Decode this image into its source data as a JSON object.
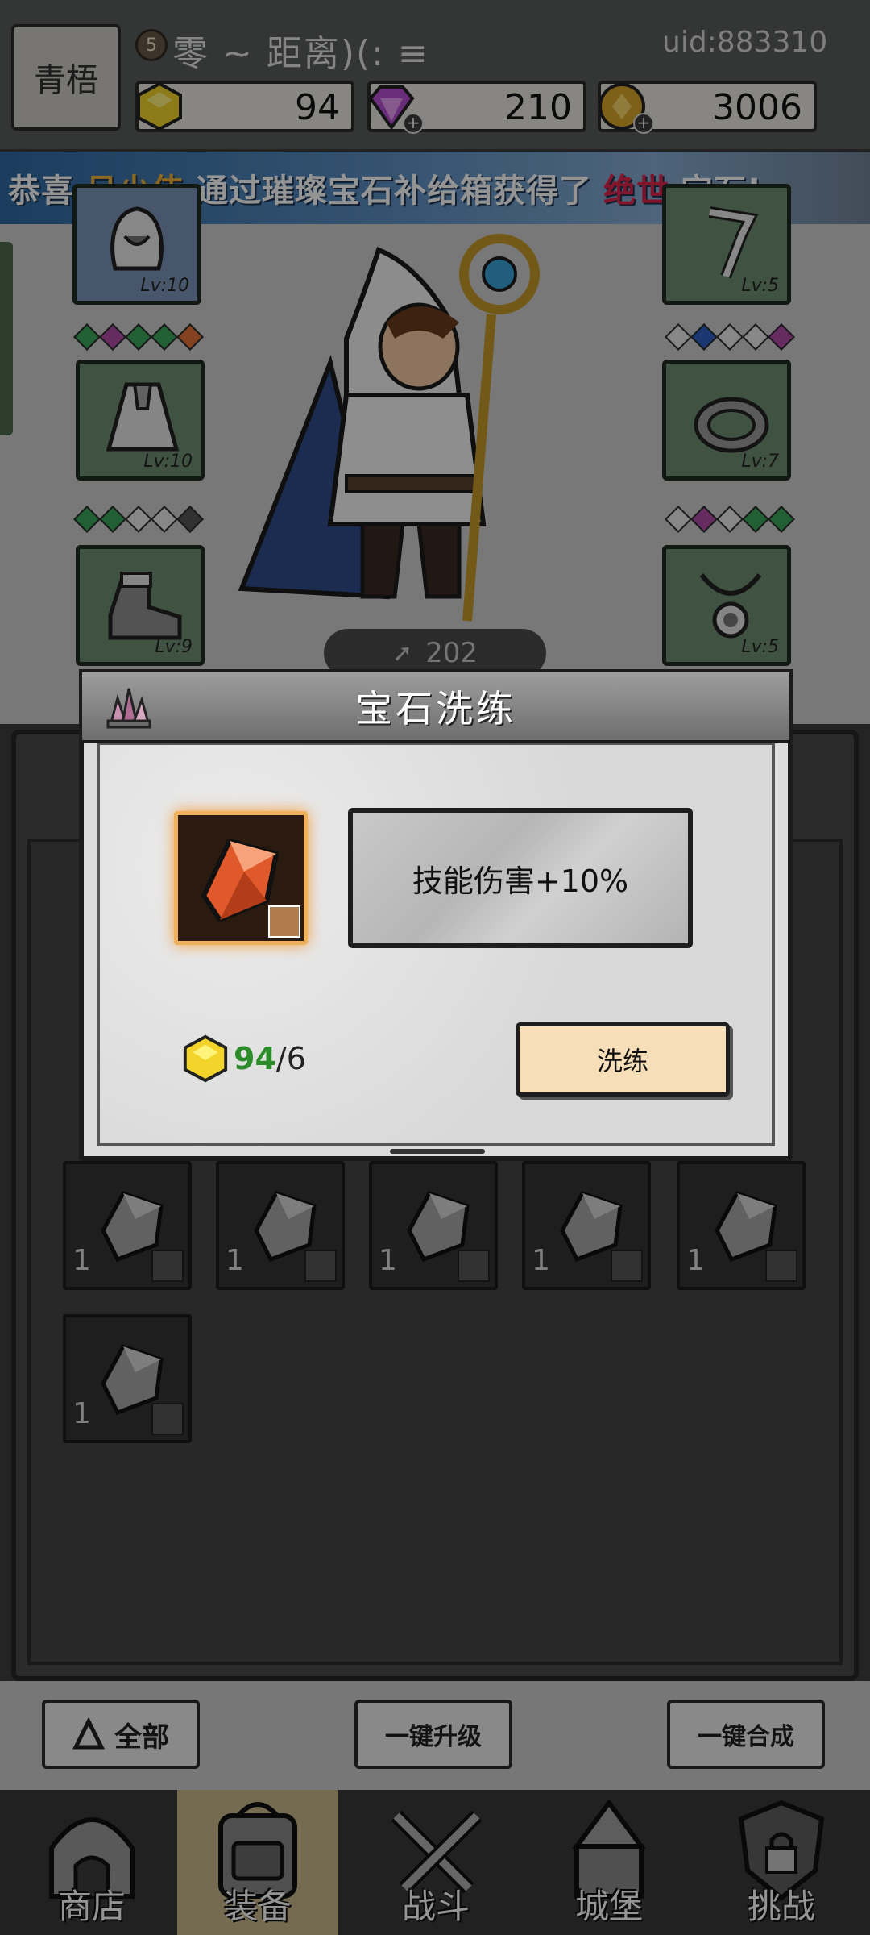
{
  "player": {
    "avatar_text": "青梧",
    "level": "5",
    "name": "零 ~ 距离)(: ≡",
    "uid": "uid:883310"
  },
  "resources": {
    "gold_gems": "94",
    "diamonds": "210",
    "coins": "3006"
  },
  "broadcast": {
    "prefix": "恭喜",
    "player": "吕少伟",
    "middle": "通过璀璨宝石补给箱获得了",
    "tier": "绝世",
    "suffix": "宝石!"
  },
  "character": {
    "power": "202",
    "slots": [
      {
        "position": "left-1",
        "level": "Lv:10"
      },
      {
        "position": "left-2",
        "level": "Lv:10"
      },
      {
        "position": "left-3",
        "level": "Lv:9"
      },
      {
        "position": "right-1",
        "level": "Lv:5"
      },
      {
        "position": "right-2",
        "level": "Lv:7"
      },
      {
        "position": "right-3",
        "level": "Lv:5"
      }
    ],
    "gem_colors": {
      "green": "#3aa55c",
      "purple": "#b04aa8",
      "orange": "#e0703a",
      "blue": "#2f5fc4",
      "empty": "#e8e8e8",
      "dark": "#555555"
    }
  },
  "inventory": {
    "items": [
      {
        "count": "1"
      },
      {
        "count": "1"
      },
      {
        "count": "1"
      },
      {
        "count": "1"
      },
      {
        "count": "1"
      },
      {
        "count": "1"
      }
    ]
  },
  "bottom_buttons": {
    "filter_label": "全部",
    "upgrade_all_label": "一键升级",
    "merge_all_label": "一键合成"
  },
  "nav": {
    "shop": "商店",
    "equipment": "装备",
    "battle": "战斗",
    "castle": "城堡",
    "challenge": "挑战"
  },
  "dialog": {
    "title": "宝石洗练",
    "stat": "技能伤害+10%",
    "cost_have": "94",
    "cost_need": "/6",
    "refine_label": "洗练"
  }
}
